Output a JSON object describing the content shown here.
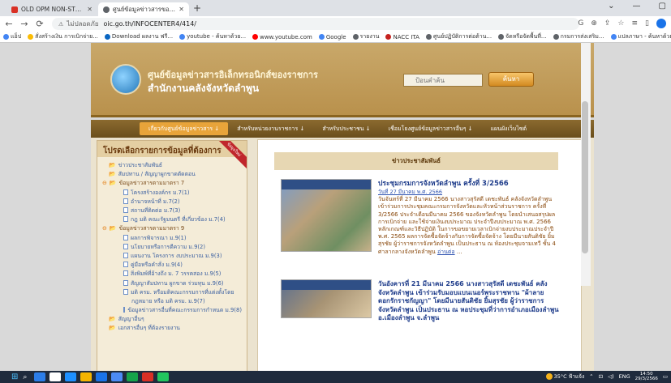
{
  "browser": {
    "tabs": [
      {
        "title": "OLD OPM NON-STOP | CLA",
        "favicon_color": "#d93025"
      },
      {
        "title": "ศูนย์ข้อมูลข่าวสารของราชการ - สำนั",
        "favicon_color": "#5f6368"
      }
    ],
    "new_tab_label": "+",
    "window_controls": [
      "⌄",
      "—",
      "▢"
    ],
    "address": {
      "secure_text": "ไม่ปลอดภัย",
      "url": "oic.go.th/INFOCENTER4/414/"
    },
    "bookmarks": [
      {
        "label": "แอ็ป",
        "color": "#4285f4"
      },
      {
        "label": "สั่งสร้างเงิน การเบิกจ่าย...",
        "color": "#fbbc04"
      },
      {
        "label": "Download ผลงาน ฟรี...",
        "color": "#0a66c2"
      },
      {
        "label": "youtube - ค้นหาด้วย...",
        "color": "#4285f4"
      },
      {
        "label": "www.youtube.com",
        "color": "#ff0000"
      },
      {
        "label": "Google",
        "color": "#4285f4"
      },
      {
        "label": "รายงาน",
        "color": "#5f6368"
      },
      {
        "label": "NACC ITA",
        "color": "#c5221f"
      },
      {
        "label": "ศูนย์ปฏิบัติการต่อต้าน...",
        "color": "#5f6368"
      },
      {
        "label": "จัดหรือจัดพื้นที่...",
        "color": "#5f6368"
      },
      {
        "label": "กรมการส่งเสริม...",
        "color": "#5f6368"
      },
      {
        "label": "แปลภาษา - ค้นหาด้วย...",
        "color": "#4285f4"
      }
    ]
  },
  "site": {
    "org_name": "ศูนย์ข้อมูลข่าวสารอิเล็กทรอนิกส์ของราชการ",
    "org_sub": "สำนักงานคลังจังหวัดลำพูน",
    "search_placeholder": "ป้อนคำค้น",
    "search_button": "ค้นหา",
    "nav": [
      "เกี่ยวกับศูนย์ข้อมูลข่าวสาร ↓",
      "สำหรับหน่วยงานราชการ ↓",
      "สำหรับประชาชน ↓",
      "เชื่อมโยงศูนย์ข้อมูลข่าวสารอื่นๆ ↓",
      "แผนผังเว็บไซต์"
    ]
  },
  "sidebar": {
    "title": "โปรดเลือกรายการข้อมูลที่ต้องการ",
    "ribbon": "ข้อมูลใหม่",
    "tree": [
      {
        "label": "ข่าวประชาสัมพันธ์",
        "level": "l0",
        "kind": "folder"
      },
      {
        "label": "สัมปทาน / สัญญาผูกขาดตัดตอน",
        "level": "l0",
        "kind": "folder"
      },
      {
        "label": "ข้อมูลข่าวสารตามมาตรา 7",
        "level": "sec",
        "kind": "section"
      },
      {
        "label": "โครงสร้างองค์กร ม.7(1)",
        "level": "l1",
        "kind": "doc"
      },
      {
        "label": "อำนาจหน้าที่ ม.7(2)",
        "level": "l1",
        "kind": "doc"
      },
      {
        "label": "สถานที่ติดต่อ ม.7(3)",
        "level": "l1",
        "kind": "doc"
      },
      {
        "label": "กฎ มติ คณะรัฐมนตรี ที่เกี่ยวข้อง ม.7(4)",
        "level": "l1",
        "kind": "doc"
      },
      {
        "label": "ข้อมูลข่าวสารตามมาตรา 9",
        "level": "sec",
        "kind": "section"
      },
      {
        "label": "ผลการพิจารณา ม.9(1)",
        "level": "l1",
        "kind": "doc"
      },
      {
        "label": "นโยบายหรือการตีความ ม.9(2)",
        "level": "l1",
        "kind": "doc"
      },
      {
        "label": "แผนงาน โครงการ งบประมาณ ม.9(3)",
        "level": "l1",
        "kind": "doc"
      },
      {
        "label": "คู่มือหรือคำสั่ง ม.9(4)",
        "level": "l1",
        "kind": "doc"
      },
      {
        "label": "สิ่งพิมพ์ที่อ้างถึง ม. 7 วรรคสอง ม.9(5)",
        "level": "l1",
        "kind": "doc"
      },
      {
        "label": "สัญญาสัมปทาน ผูกขาด ร่วมทุน ม.9(6)",
        "level": "l1",
        "kind": "doc"
      },
      {
        "label": "มติ ครม. หรือมติคณะกรรมการที่แต่งตั้งโดย",
        "level": "l1",
        "kind": "doc"
      },
      {
        "label": "กฎหมาย หรือ มติ ครม. ม.9(7)",
        "level": "l1",
        "kind": "cont"
      },
      {
        "label": "ข้อมูลข่าวสารอื่นที่คณะกรรมการกำหนด ม.9(8)",
        "level": "l1",
        "kind": "doc"
      },
      {
        "label": "สัญญาอื่นๆ",
        "level": "l0",
        "kind": "folder"
      },
      {
        "label": "เอกสารอื่นๆ ที่ต้องรายงาน",
        "level": "l0",
        "kind": "folder"
      }
    ]
  },
  "main": {
    "header": "ข่าวประชาสัมพันธ์",
    "news": [
      {
        "title": "ประชุมกรมการจังหวัดลำพูน ครั้งที่ 3/2566",
        "date": "วันที่ 27 มีนาคม พ.ศ. 2566",
        "body": "วันจันทร์ที่ 27 มีนาคม 2566 นางสาวสุรัสดี เดชะพันธ์ คลังจังหวัดลำพูน เข้าร่วมการประชุมคณะกรมการจังหวัดและหัวหน้าส่วนราชการ ครั้งที่ 3/2566 ประจำเดือนมีนาคม 2566 ของจังหวัดลำพูน โดยนำเสนอสรุปผลการเบิกจ่าย และใช้จ่ายเงินงบประมาณ ประจำปีงบประมาณ พ.ศ. 2566 หลักเกณฑ์และวิธีปฏิบัติ ในการขอขยายเวลาเบิกจ่ายงบประมาณประจำปี พ.ศ. 2565 ผลการจัดซื้อจัดจ้างกับการจัดซื้อจัดจ้าง โดยมีนายสันติชัย ยิ้มสุรชัย ผู้ว่าราชการจังหวัดลำพูน เป็นประธาน ณ ห้องประชุมจามเทวี ชั้น 4 ศาลากลางจังหวัดลำพูน",
        "read_more": "อ่านต่อ",
        "ellipsis": "..."
      },
      {
        "title": "วันอังคารที่ 21 มีนาคม 2566 นางสาวสุรัสดี เดชะพันธ์ คลังจังหวัดลำพูน เข้าร่วมรับมอบแบนเนอร์พระราชทาน \"ผ้าลายดอกรักราชกัญญา\" โดยมีนายสันติชัย ยิ้มสุรชัย ผู้ว่าราชการจังหวัดลำพูน เป็นประธาน ณ หอประชุมที่ว่าการอำเภอเมืองลำพูน อ.เมืองลำพูน จ.ลำพูน"
      }
    ]
  },
  "taskbar": {
    "icons": [
      "#2b7de9",
      "#ffffff",
      "#1e90ff",
      "#f4b400",
      "#1a73e8",
      "#4c8bf5",
      "#16a34a",
      "#d93025",
      "#22c55e"
    ],
    "weather": "35°C ฟ้าแจ้ง",
    "lang": "ENG",
    "time": "14:50",
    "date": "29/3/2566"
  }
}
